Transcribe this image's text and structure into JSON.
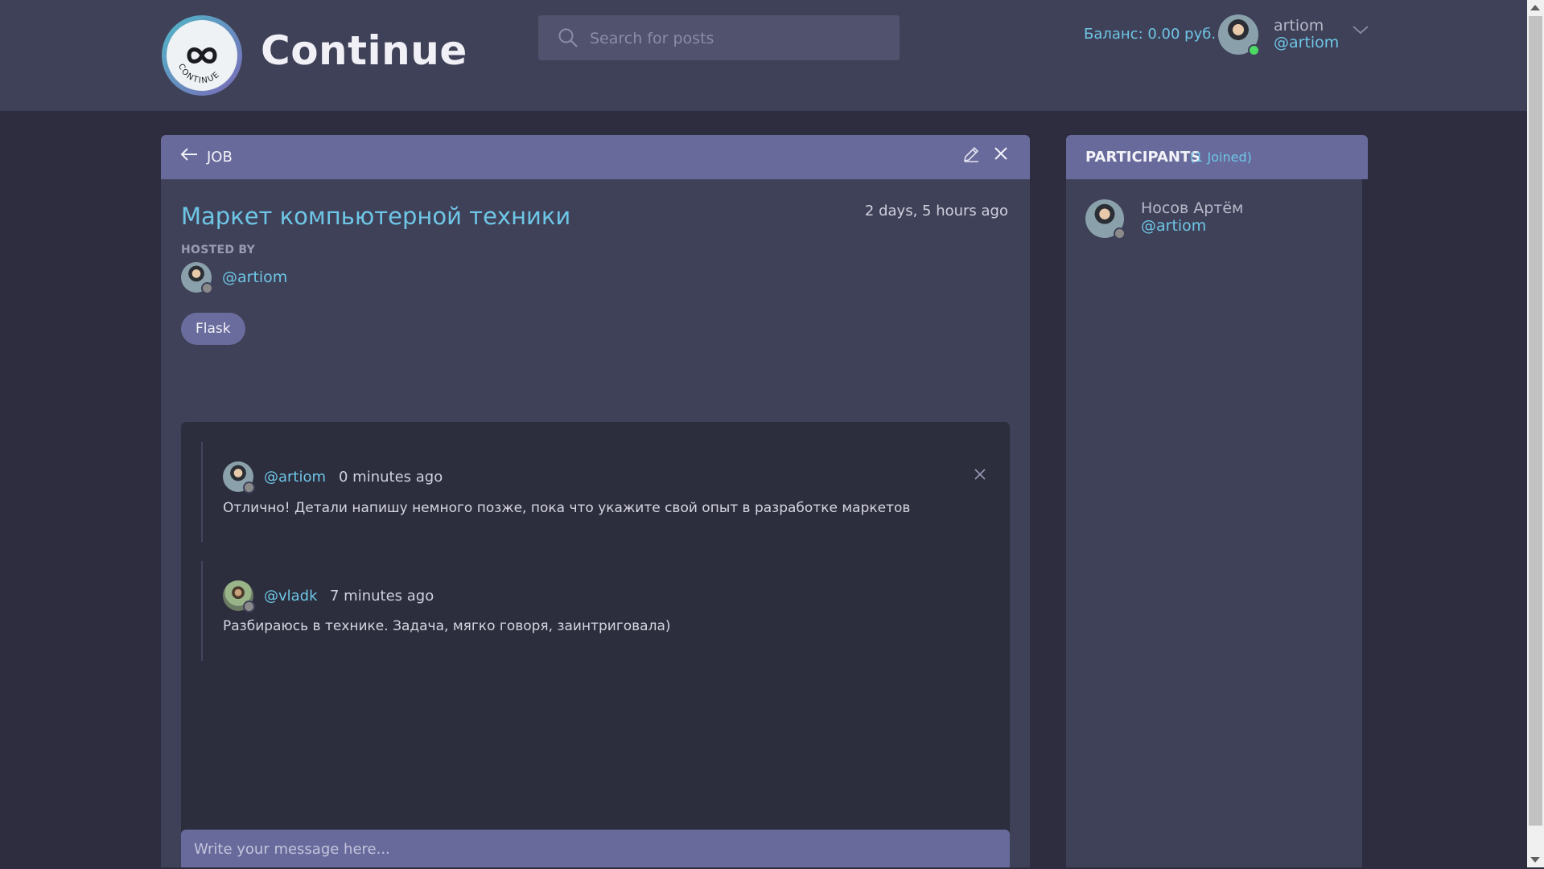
{
  "header": {
    "app_title": "Continue",
    "logo_text": "CONTINUE",
    "search_placeholder": "Search for posts",
    "balance": "Баланс: 0.00 руб.",
    "user_name": "artiom",
    "user_handle": "@artiom"
  },
  "room": {
    "back_label": "JOB",
    "title": "Маркет компьютерной техники",
    "created": "2 days, 5 hours ago",
    "hosted_label": "HOSTED BY",
    "host_handle": "@artiom",
    "tag": "Flask",
    "messages": [
      {
        "handle": "@artiom",
        "time": "0 minutes ago",
        "body": "Отлично! Детали напишу немного позже, пока что укажите свой опыт в разработке маркетов"
      },
      {
        "handle": "@vladk",
        "time": "7 minutes ago",
        "body": "Разбираюсь в технике. Задача, мягко говоря, заинтриговала)"
      }
    ],
    "composer_placeholder": "Write your message here..."
  },
  "participants": {
    "title": "PARTICIPANTS",
    "count": "(1 Joined)",
    "list": [
      {
        "name": "Носов Артём",
        "handle": "@artiom"
      }
    ]
  },
  "colors": {
    "accent": "#6ec6e6",
    "header_bg": "#3f4158",
    "panel_head": "#686a9b",
    "page_bg": "#2d2d3f",
    "thread_bg": "#2c2d3d",
    "online": "#4cd964"
  },
  "icons": {
    "logo": "infinity-logo-icon",
    "search": "search-icon",
    "dropdown": "chevron-down-icon",
    "back": "arrow-left-icon",
    "edit": "pencil-icon",
    "close": "close-icon"
  }
}
